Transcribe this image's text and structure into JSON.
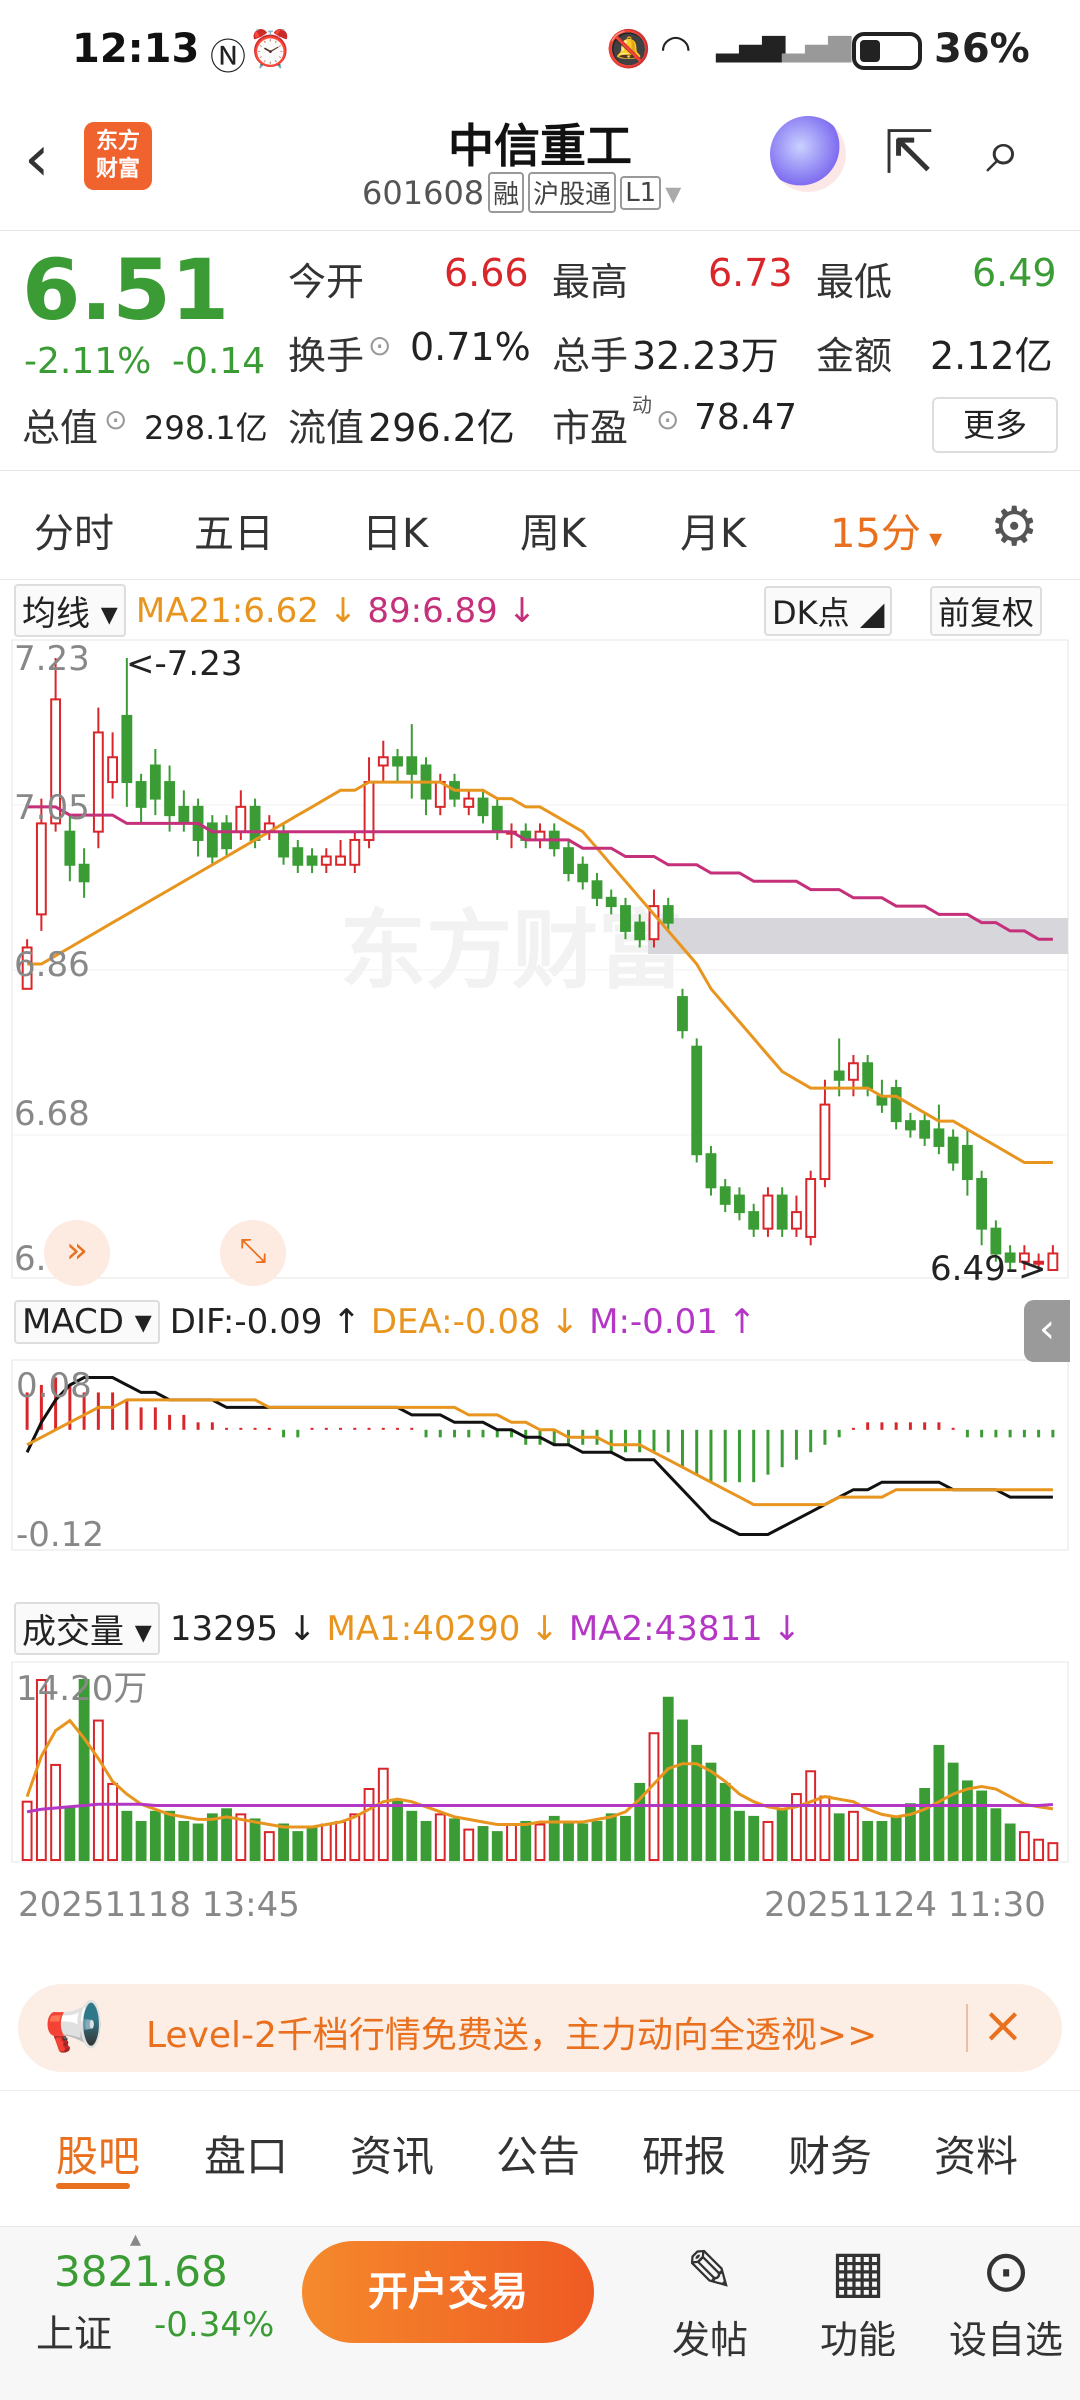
{
  "status_bar": {
    "time": "12:13",
    "battery_pct": "36%"
  },
  "header": {
    "stock_name": "中信重工",
    "code": "601608",
    "tag_margin": "融",
    "tag_connect": "沪股通",
    "tag_level": "L1",
    "logo_text_1": "东方",
    "logo_text_2": "财富"
  },
  "quote": {
    "price": "6.51",
    "change_pct": "-2.11%",
    "change": "-0.14",
    "open_label": "今开",
    "open": "6.66",
    "high_label": "最高",
    "high": "6.73",
    "low_label": "最低",
    "low": "6.49",
    "turnover_label": "换手",
    "turnover": "0.71%",
    "volume_label": "总手",
    "volume": "32.23万",
    "amount_label": "金额",
    "amount": "2.12亿",
    "mktcap_label": "总值",
    "mktcap": "298.1亿",
    "float_label": "流值",
    "float_cap": "296.2亿",
    "pe_label": "市盈",
    "pe_sup": "动",
    "pe": "78.47",
    "more": "更多"
  },
  "period_tabs": [
    "分时",
    "五日",
    "日K",
    "周K",
    "月K",
    "15分"
  ],
  "active_period": "15分",
  "main_chart": {
    "indicator": "均线",
    "ma21": "MA21:6.62",
    "ma89": "89:6.89",
    "dk": "DK点",
    "adjust": "前复权",
    "watermark": "东方财富",
    "price_labels": [
      "7.23",
      "7.05",
      "6.86",
      "6.68",
      "6.49"
    ],
    "high_marker": "<-7.23",
    "low_marker": "6.49->"
  },
  "macd": {
    "name": "MACD",
    "dif": "DIF:-0.09",
    "dea": "DEA:-0.08",
    "m": "M:-0.01",
    "top": "0.08",
    "bottom": "-0.12"
  },
  "volume": {
    "name": "成交量",
    "current": "13295",
    "ma1": "MA1:40290",
    "ma2": "MA2:43811",
    "top": "14.20万",
    "start_time": "20251118 13:45",
    "end_time": "20251124 11:30"
  },
  "chart_data": {
    "type": "candlestick",
    "ylim": [
      6.49,
      7.23
    ],
    "candles": [
      {
        "o": 6.83,
        "c": 6.88,
        "h": 6.89,
        "l": 6.83
      },
      {
        "o": 6.92,
        "c": 7.03,
        "h": 7.06,
        "l": 6.9
      },
      {
        "o": 7.03,
        "c": 7.18,
        "h": 7.23,
        "l": 7.02
      },
      {
        "o": 7.02,
        "c": 6.98,
        "h": 7.04,
        "l": 6.96
      },
      {
        "o": 6.98,
        "c": 6.96,
        "h": 7.0,
        "l": 6.94
      },
      {
        "o": 7.02,
        "c": 7.14,
        "h": 7.17,
        "l": 7.0
      },
      {
        "o": 7.08,
        "c": 7.11,
        "h": 7.14,
        "l": 7.06
      },
      {
        "o": 7.16,
        "c": 7.08,
        "h": 7.23,
        "l": 7.05
      },
      {
        "o": 7.08,
        "c": 7.05,
        "h": 7.09,
        "l": 7.03
      },
      {
        "o": 7.1,
        "c": 7.06,
        "h": 7.12,
        "l": 7.04
      },
      {
        "o": 7.08,
        "c": 7.04,
        "h": 7.1,
        "l": 7.02
      },
      {
        "o": 7.05,
        "c": 7.03,
        "h": 7.07,
        "l": 7.02
      },
      {
        "o": 7.05,
        "c": 7.01,
        "h": 7.06,
        "l": 6.99
      },
      {
        "o": 7.03,
        "c": 6.99,
        "h": 7.04,
        "l": 6.98
      },
      {
        "o": 7.03,
        "c": 7.0,
        "h": 7.04,
        "l": 6.99
      },
      {
        "o": 7.02,
        "c": 7.05,
        "h": 7.07,
        "l": 7.01
      },
      {
        "o": 7.05,
        "c": 7.01,
        "h": 7.06,
        "l": 7.0
      },
      {
        "o": 7.02,
        "c": 7.03,
        "h": 7.04,
        "l": 7.01
      },
      {
        "o": 7.02,
        "c": 6.99,
        "h": 7.03,
        "l": 6.98
      },
      {
        "o": 7.0,
        "c": 6.98,
        "h": 7.01,
        "l": 6.97
      },
      {
        "o": 6.99,
        "c": 6.98,
        "h": 7.0,
        "l": 6.97
      },
      {
        "o": 6.98,
        "c": 6.99,
        "h": 7.0,
        "l": 6.97
      },
      {
        "o": 6.98,
        "c": 6.99,
        "h": 7.01,
        "l": 6.98
      },
      {
        "o": 6.98,
        "c": 7.01,
        "h": 7.02,
        "l": 6.97
      },
      {
        "o": 7.01,
        "c": 7.08,
        "h": 7.11,
        "l": 7.0
      },
      {
        "o": 7.1,
        "c": 7.11,
        "h": 7.13,
        "l": 7.08
      },
      {
        "o": 7.11,
        "c": 7.1,
        "h": 7.12,
        "l": 7.08
      },
      {
        "o": 7.11,
        "c": 7.09,
        "h": 7.15,
        "l": 7.06
      },
      {
        "o": 7.1,
        "c": 7.06,
        "h": 7.11,
        "l": 7.04
      },
      {
        "o": 7.05,
        "c": 7.08,
        "h": 7.09,
        "l": 7.04
      },
      {
        "o": 7.08,
        "c": 7.06,
        "h": 7.09,
        "l": 7.05
      },
      {
        "o": 7.05,
        "c": 7.06,
        "h": 7.07,
        "l": 7.04
      },
      {
        "o": 7.06,
        "c": 7.04,
        "h": 7.07,
        "l": 7.03
      },
      {
        "o": 7.05,
        "c": 7.02,
        "h": 7.06,
        "l": 7.01
      },
      {
        "o": 7.02,
        "c": 7.02,
        "h": 7.03,
        "l": 7.0
      },
      {
        "o": 7.02,
        "c": 7.01,
        "h": 7.03,
        "l": 7.0
      },
      {
        "o": 7.01,
        "c": 7.02,
        "h": 7.03,
        "l": 7.0
      },
      {
        "o": 7.02,
        "c": 7.0,
        "h": 7.03,
        "l": 6.99
      },
      {
        "o": 7.0,
        "c": 6.97,
        "h": 7.01,
        "l": 6.96
      },
      {
        "o": 6.98,
        "c": 6.96,
        "h": 6.99,
        "l": 6.95
      },
      {
        "o": 6.96,
        "c": 6.94,
        "h": 6.97,
        "l": 6.93
      },
      {
        "o": 6.94,
        "c": 6.93,
        "h": 6.95,
        "l": 6.92
      },
      {
        "o": 6.93,
        "c": 6.9,
        "h": 6.94,
        "l": 6.89
      },
      {
        "o": 6.91,
        "c": 6.89,
        "h": 6.92,
        "l": 6.88
      },
      {
        "o": 6.89,
        "c": 6.93,
        "h": 6.95,
        "l": 6.88
      },
      {
        "o": 6.93,
        "c": 6.91,
        "h": 6.94,
        "l": 6.9
      },
      {
        "o": 6.82,
        "c": 6.78,
        "h": 6.83,
        "l": 6.77
      },
      {
        "o": 6.76,
        "c": 6.63,
        "h": 6.77,
        "l": 6.62
      },
      {
        "o": 6.63,
        "c": 6.59,
        "h": 6.64,
        "l": 6.58
      },
      {
        "o": 6.59,
        "c": 6.57,
        "h": 6.6,
        "l": 6.56
      },
      {
        "o": 6.58,
        "c": 6.56,
        "h": 6.59,
        "l": 6.55
      },
      {
        "o": 6.56,
        "c": 6.54,
        "h": 6.57,
        "l": 6.53
      },
      {
        "o": 6.54,
        "c": 6.58,
        "h": 6.59,
        "l": 6.53
      },
      {
        "o": 6.58,
        "c": 6.54,
        "h": 6.59,
        "l": 6.53
      },
      {
        "o": 6.54,
        "c": 6.56,
        "h": 6.58,
        "l": 6.53
      },
      {
        "o": 6.53,
        "c": 6.6,
        "h": 6.61,
        "l": 6.52
      },
      {
        "o": 6.6,
        "c": 6.69,
        "h": 6.72,
        "l": 6.59
      },
      {
        "o": 6.73,
        "c": 6.72,
        "h": 6.77,
        "l": 6.7
      },
      {
        "o": 6.72,
        "c": 6.74,
        "h": 6.75,
        "l": 6.7
      },
      {
        "o": 6.74,
        "c": 6.71,
        "h": 6.75,
        "l": 6.7
      },
      {
        "o": 6.7,
        "c": 6.69,
        "h": 6.72,
        "l": 6.68
      },
      {
        "o": 6.71,
        "c": 6.67,
        "h": 6.72,
        "l": 6.66
      },
      {
        "o": 6.67,
        "c": 6.66,
        "h": 6.68,
        "l": 6.65
      },
      {
        "o": 6.67,
        "c": 6.65,
        "h": 6.68,
        "l": 6.64
      },
      {
        "o": 6.66,
        "c": 6.64,
        "h": 6.69,
        "l": 6.63
      },
      {
        "o": 6.65,
        "c": 6.62,
        "h": 6.66,
        "l": 6.61
      },
      {
        "o": 6.64,
        "c": 6.6,
        "h": 6.66,
        "l": 6.58
      },
      {
        "o": 6.6,
        "c": 6.54,
        "h": 6.61,
        "l": 6.52
      },
      {
        "o": 6.54,
        "c": 6.51,
        "h": 6.55,
        "l": 6.5
      },
      {
        "o": 6.51,
        "c": 6.5,
        "h": 6.52,
        "l": 6.49
      },
      {
        "o": 6.5,
        "c": 6.51,
        "h": 6.52,
        "l": 6.49
      },
      {
        "o": 6.5,
        "c": 6.5,
        "h": 6.51,
        "l": 6.49
      },
      {
        "o": 6.49,
        "c": 6.51,
        "h": 6.52,
        "l": 6.49
      }
    ],
    "ma21": [
      6.86,
      6.86,
      6.87,
      6.88,
      6.89,
      6.9,
      6.91,
      6.92,
      6.93,
      6.94,
      6.95,
      6.96,
      6.97,
      6.98,
      6.99,
      7.0,
      7.01,
      7.02,
      7.03,
      7.04,
      7.05,
      7.06,
      7.07,
      7.07,
      7.08,
      7.08,
      7.08,
      7.08,
      7.08,
      7.08,
      7.07,
      7.07,
      7.07,
      7.06,
      7.06,
      7.05,
      7.05,
      7.04,
      7.03,
      7.02,
      7.0,
      6.98,
      6.96,
      6.94,
      6.92,
      6.9,
      6.88,
      6.86,
      6.83,
      6.81,
      6.79,
      6.77,
      6.75,
      6.73,
      6.72,
      6.71,
      6.71,
      6.71,
      6.71,
      6.71,
      6.7,
      6.7,
      6.69,
      6.68,
      6.67,
      6.67,
      6.66,
      6.65,
      6.64,
      6.63,
      6.62,
      6.62,
      6.62
    ],
    "ma89": [
      7.05,
      7.05,
      7.05,
      7.04,
      7.04,
      7.04,
      7.04,
      7.03,
      7.03,
      7.03,
      7.03,
      7.03,
      7.03,
      7.02,
      7.02,
      7.02,
      7.02,
      7.02,
      7.02,
      7.02,
      7.02,
      7.02,
      7.02,
      7.02,
      7.02,
      7.02,
      7.02,
      7.02,
      7.02,
      7.02,
      7.02,
      7.02,
      7.02,
      7.02,
      7.02,
      7.01,
      7.01,
      7.01,
      7.01,
      7.0,
      7.0,
      7.0,
      6.99,
      6.99,
      6.99,
      6.98,
      6.98,
      6.98,
      6.97,
      6.97,
      6.97,
      6.96,
      6.96,
      6.96,
      6.96,
      6.95,
      6.95,
      6.95,
      6.94,
      6.94,
      6.94,
      6.93,
      6.93,
      6.93,
      6.92,
      6.92,
      6.92,
      6.91,
      6.91,
      6.9,
      6.9,
      6.89,
      6.89
    ],
    "macd_hist": [
      0.05,
      0.06,
      0.07,
      0.06,
      0.05,
      0.05,
      0.05,
      0.04,
      0.03,
      0.03,
      0.02,
      0.02,
      0.01,
      0.01,
      0.0,
      0.0,
      0.0,
      0.0,
      -0.01,
      -0.01,
      -0.0,
      0.0,
      0.0,
      0.0,
      0.0,
      0.0,
      0.0,
      0.0,
      -0.01,
      -0.01,
      -0.01,
      -0.01,
      -0.01,
      -0.01,
      -0.01,
      -0.02,
      -0.02,
      -0.02,
      -0.02,
      -0.02,
      -0.02,
      -0.03,
      -0.03,
      -0.03,
      -0.03,
      -0.03,
      -0.05,
      -0.06,
      -0.07,
      -0.07,
      -0.07,
      -0.07,
      -0.06,
      -0.05,
      -0.04,
      -0.03,
      -0.02,
      -0.01,
      0.0,
      0.01,
      0.01,
      0.01,
      0.01,
      0.01,
      0.01,
      0.0,
      -0.01,
      -0.01,
      -0.01,
      -0.01,
      -0.01,
      -0.01,
      -0.01
    ],
    "dif": [
      -0.03,
      0.01,
      0.04,
      0.06,
      0.07,
      0.07,
      0.07,
      0.06,
      0.05,
      0.05,
      0.04,
      0.04,
      0.04,
      0.04,
      0.03,
      0.03,
      0.03,
      0.03,
      0.03,
      0.03,
      0.03,
      0.03,
      0.03,
      0.03,
      0.03,
      0.03,
      0.03,
      0.02,
      0.02,
      0.02,
      0.01,
      0.01,
      0.01,
      0.0,
      0.0,
      -0.01,
      -0.01,
      -0.02,
      -0.02,
      -0.03,
      -0.03,
      -0.03,
      -0.04,
      -0.04,
      -0.04,
      -0.06,
      -0.08,
      -0.1,
      -0.12,
      -0.13,
      -0.14,
      -0.14,
      -0.14,
      -0.13,
      -0.12,
      -0.11,
      -0.1,
      -0.09,
      -0.08,
      -0.08,
      -0.07,
      -0.07,
      -0.07,
      -0.07,
      -0.07,
      -0.08,
      -0.08,
      -0.08,
      -0.08,
      -0.09,
      -0.09,
      -0.09,
      -0.09
    ],
    "dea": [
      -0.02,
      -0.01,
      0.0,
      0.01,
      0.02,
      0.03,
      0.03,
      0.04,
      0.04,
      0.04,
      0.04,
      0.04,
      0.04,
      0.04,
      0.04,
      0.04,
      0.04,
      0.03,
      0.03,
      0.03,
      0.03,
      0.03,
      0.03,
      0.03,
      0.03,
      0.03,
      0.03,
      0.03,
      0.03,
      0.03,
      0.03,
      0.02,
      0.02,
      0.02,
      0.01,
      0.01,
      0.0,
      0.0,
      -0.01,
      -0.01,
      -0.01,
      -0.02,
      -0.02,
      -0.02,
      -0.03,
      -0.04,
      -0.05,
      -0.06,
      -0.07,
      -0.08,
      -0.09,
      -0.1,
      -0.1,
      -0.1,
      -0.1,
      -0.1,
      -0.1,
      -0.09,
      -0.09,
      -0.09,
      -0.09,
      -0.08,
      -0.08,
      -0.08,
      -0.08,
      -0.08,
      -0.08,
      -0.08,
      -0.08,
      -0.08,
      -0.08,
      -0.08,
      -0.08
    ],
    "volumes": [
      46000,
      142000,
      75000,
      42000,
      142000,
      110000,
      60000,
      38000,
      30000,
      38000,
      38000,
      30000,
      28000,
      36000,
      40000,
      36000,
      32000,
      22000,
      28000,
      22000,
      26000,
      28000,
      30000,
      36000,
      56000,
      72000,
      46000,
      38000,
      30000,
      36000,
      32000,
      24000,
      26000,
      22000,
      28000,
      30000,
      28000,
      34000,
      30000,
      28000,
      30000,
      36000,
      34000,
      60000,
      100000,
      128000,
      110000,
      90000,
      76000,
      60000,
      38000,
      34000,
      30000,
      40000,
      52000,
      70000,
      50000,
      36000,
      38000,
      30000,
      30000,
      34000,
      44000,
      56000,
      90000,
      76000,
      62000,
      54000,
      40000,
      28000,
      22000,
      16000,
      13295
    ],
    "vol_ma1": [
      50000,
      82000,
      102000,
      110000,
      96000,
      80000,
      62000,
      52000,
      44000,
      40000,
      36000,
      34000,
      32000,
      32000,
      34000,
      32000,
      30000,
      28000,
      26000,
      26000,
      26000,
      28000,
      30000,
      34000,
      40000,
      46000,
      48000,
      46000,
      42000,
      38000,
      34000,
      32000,
      30000,
      28000,
      28000,
      28000,
      30000,
      30000,
      30000,
      30000,
      32000,
      34000,
      38000,
      48000,
      60000,
      72000,
      76000,
      76000,
      70000,
      62000,
      52000,
      46000,
      42000,
      40000,
      42000,
      46000,
      50000,
      48000,
      46000,
      40000,
      36000,
      34000,
      36000,
      40000,
      46000,
      52000,
      56000,
      58000,
      56000,
      50000,
      44000,
      42000,
      40290
    ],
    "vol_ma2": [
      38000,
      40000,
      41000,
      42000,
      43000,
      44000,
      44000,
      44000,
      44000,
      43000,
      43000,
      43000,
      43000,
      43000,
      43000,
      43000,
      43000,
      43000,
      43000,
      43000,
      43000,
      43000,
      43000,
      43000,
      43000,
      43000,
      43000,
      43000,
      43000,
      43000,
      43000,
      43000,
      43000,
      43000,
      43000,
      43000,
      43000,
      43000,
      43000,
      43000,
      43000,
      43000,
      43000,
      43000,
      43000,
      43000,
      43000,
      43000,
      43000,
      43000,
      43000,
      43000,
      43000,
      43000,
      43000,
      43000,
      43000,
      43000,
      43000,
      43000,
      43000,
      43000,
      43000,
      43000,
      43000,
      43000,
      43000,
      43000,
      43000,
      43000,
      43000,
      43000,
      43811
    ]
  },
  "promo": {
    "text": "Level-2千档行情免费送，主力动向全透视>>"
  },
  "bottom_tabs": [
    "股吧",
    "盘口",
    "资讯",
    "公告",
    "研报",
    "财务",
    "资料"
  ],
  "footer": {
    "index_value": "3821.68",
    "index_name": "上证",
    "index_pct": "-0.34%",
    "open_account": "开户交易",
    "post": "发帖",
    "functions": "功能",
    "watchlist": "设自选"
  },
  "colors": {
    "up": "#d9262b",
    "down": "#3b9c35",
    "accent": "#e8701f",
    "ma89": "#c5307a"
  }
}
